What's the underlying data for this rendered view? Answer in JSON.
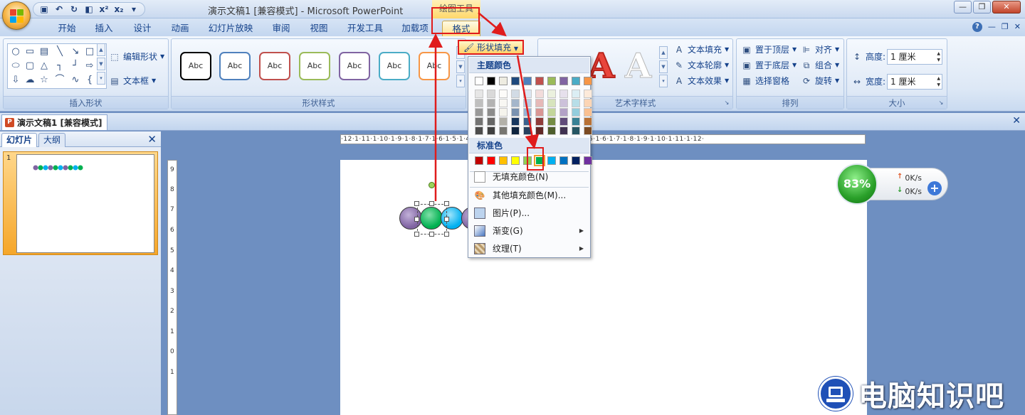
{
  "window": {
    "title": "演示文稿1 [兼容模式] - Microsoft PowerPoint",
    "context_tools": "绘图工具"
  },
  "tabs": [
    "开始",
    "插入",
    "设计",
    "动画",
    "幻灯片放映",
    "审阅",
    "视图",
    "开发工具",
    "加载项",
    "格式"
  ],
  "active_tab": "格式",
  "ribbon": {
    "insert_shapes": {
      "label": "插入形状",
      "edit_shape": "编辑形状",
      "text_box": "文本框"
    },
    "shape_styles": {
      "label": "形状样式",
      "thumb_text": "Abc",
      "fill_button": "形状填充"
    },
    "wordart": {
      "label": "艺术字样式",
      "text_fill": "文本填充",
      "text_outline": "文本轮廓",
      "text_effect": "文本效果"
    },
    "arrange": {
      "label": "排列",
      "bring_front": "置于顶层",
      "send_back": "置于底层",
      "selection_pane": "选择窗格",
      "align": "对齐",
      "group": "组合",
      "rotate": "旋转"
    },
    "size": {
      "label": "大小",
      "height_label": "高度:",
      "height_value": "1 厘米",
      "width_label": "宽度:",
      "width_value": "1 厘米"
    }
  },
  "document_tab": "演示文稿1 [兼容模式]",
  "left_pane": {
    "tab_slides": "幻灯片",
    "tab_outline": "大纲",
    "slide_number": "1"
  },
  "fill_menu": {
    "theme_colors_heading": "主题颜色",
    "standard_colors_heading": "标准色",
    "items": {
      "no_fill": "无填充颜色(N)",
      "more_colors": "其他填充颜色(M)...",
      "picture": "图片(P)...",
      "gradient": "渐变(G)",
      "texture": "纹理(T)"
    },
    "theme_top_row": [
      "#ffffff",
      "#000000",
      "#eeece1",
      "#1f497d",
      "#4f81bd",
      "#c0504d",
      "#9bbb59",
      "#8064a2",
      "#4bacc6",
      "#f79646"
    ],
    "standard_colors": [
      "#c00000",
      "#ff0000",
      "#ffc000",
      "#ffff00",
      "#92d050",
      "#00b050",
      "#00b0f0",
      "#0070c0",
      "#002060",
      "#7030a0"
    ],
    "selected_standard": 5
  },
  "ruler": {
    "horizontal": "·12·1·11·1·10·1·9·1·8·1·7·1·6·1·5·1·4·1·3·1·2·1·1·1·0·1·1·1·2·1·3·1·4·1·5·1·6·1·7·1·8·1·9·1·10·1·11·1·12·",
    "vertical": [
      "9",
      "8",
      "7",
      "6",
      "5",
      "4",
      "3",
      "2",
      "1",
      "0",
      "1"
    ]
  },
  "network_widget": {
    "percent": "83%",
    "upload": "0K/s",
    "download": "0K/s"
  },
  "watermark": "电脑知识吧",
  "colors": {
    "shape_purple": "#8064a2",
    "shape_green": "#00b050",
    "shape_blue": "#00b0f0",
    "annotation_red": "#e01c1c"
  }
}
